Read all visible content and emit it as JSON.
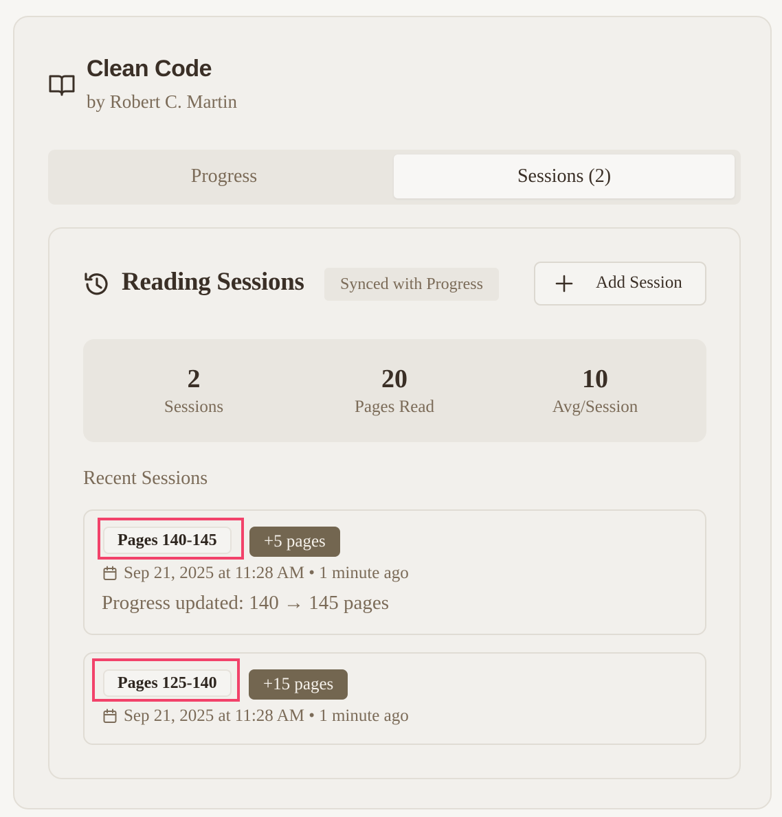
{
  "book": {
    "title": "Clean Code",
    "author": "by Robert C. Martin",
    "icon": "open-book-icon"
  },
  "tabs": [
    {
      "label": "Progress",
      "active": false
    },
    {
      "label": "Sessions (2)",
      "active": true
    }
  ],
  "sessions_panel": {
    "title": "Reading Sessions",
    "icon": "history-icon",
    "synced_badge": "Synced with Progress",
    "add_button": {
      "icon": "plus-icon",
      "label": "Add Session"
    }
  },
  "stats": [
    {
      "value": "2",
      "label": "Sessions"
    },
    {
      "value": "20",
      "label": "Pages Read"
    },
    {
      "value": "10",
      "label": "Avg/Session"
    }
  ],
  "recent_heading": "Recent Sessions",
  "sessions": [
    {
      "range": "Pages 140-145",
      "delta": "+5 pages",
      "date": "Sep 21, 2025 at 11:28 AM • 1 minute ago",
      "note": "Progress updated: 140 → 145 pages"
    },
    {
      "range": "Pages 125-140",
      "delta": "+15 pages",
      "date": "Sep 21, 2025 at 11:28 AM • 1 minute ago"
    }
  ],
  "colors": {
    "accent": "#736650",
    "highlight": "#f2426a",
    "background": "#f2f0ec",
    "text_primary": "#3a2f26",
    "text_muted": "#7b6b58"
  }
}
